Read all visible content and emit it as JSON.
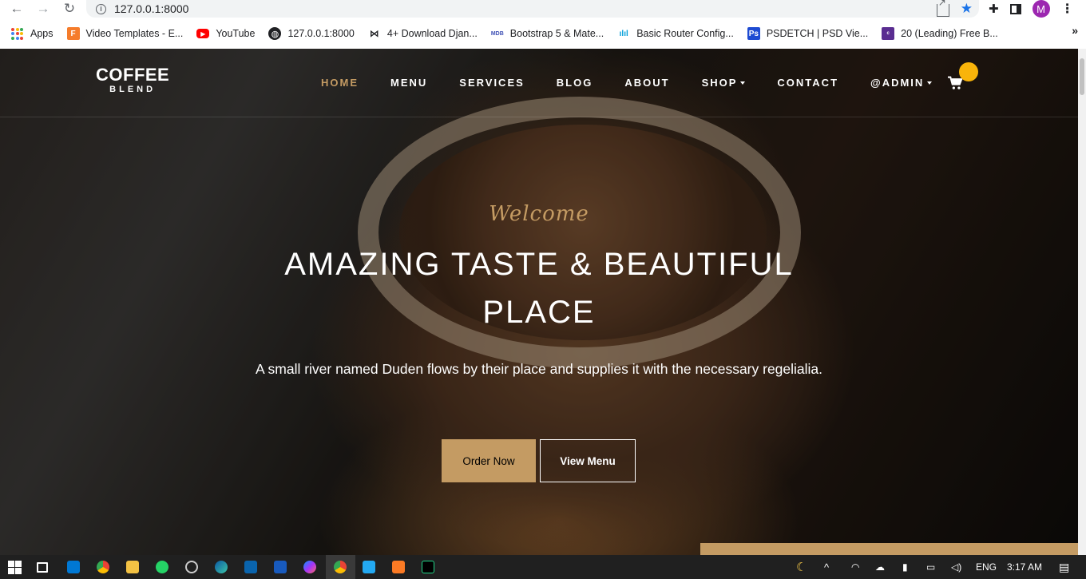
{
  "browser": {
    "url": "127.0.0.1:8000",
    "avatar_letter": "M",
    "bookmarks": [
      {
        "label": "Apps"
      },
      {
        "label": "Video Templates - E..."
      },
      {
        "label": "YouTube"
      },
      {
        "label": "127.0.0.1:8000"
      },
      {
        "label": "4+ Download Djan..."
      },
      {
        "label": "Bootstrap 5 & Mate..."
      },
      {
        "label": "Basic Router Config..."
      },
      {
        "label": "PSDETCH | PSD Vie..."
      },
      {
        "label": "20 (Leading) Free B..."
      }
    ]
  },
  "site": {
    "logo_top": "COFFEE",
    "logo_bottom": "BLEND",
    "nav": [
      "HOME",
      "MENU",
      "SERVICES",
      "BLOG",
      "ABOUT",
      "SHOP",
      "CONTACT",
      "@ADMIN"
    ],
    "active_nav": "HOME",
    "accent_color": "#c49b63",
    "cart_badge_color": "#f9b40a"
  },
  "hero": {
    "welcome": "Welcome",
    "headline": "AMAZING TASTE & BEAUTIFUL PLACE",
    "subtitle": "A small river named Duden flows by their place and supplies it with the necessary regelialia.",
    "order_button": "Order Now",
    "menu_button": "View Menu"
  },
  "taskbar": {
    "language": "ENG",
    "time": "3:17 AM"
  }
}
